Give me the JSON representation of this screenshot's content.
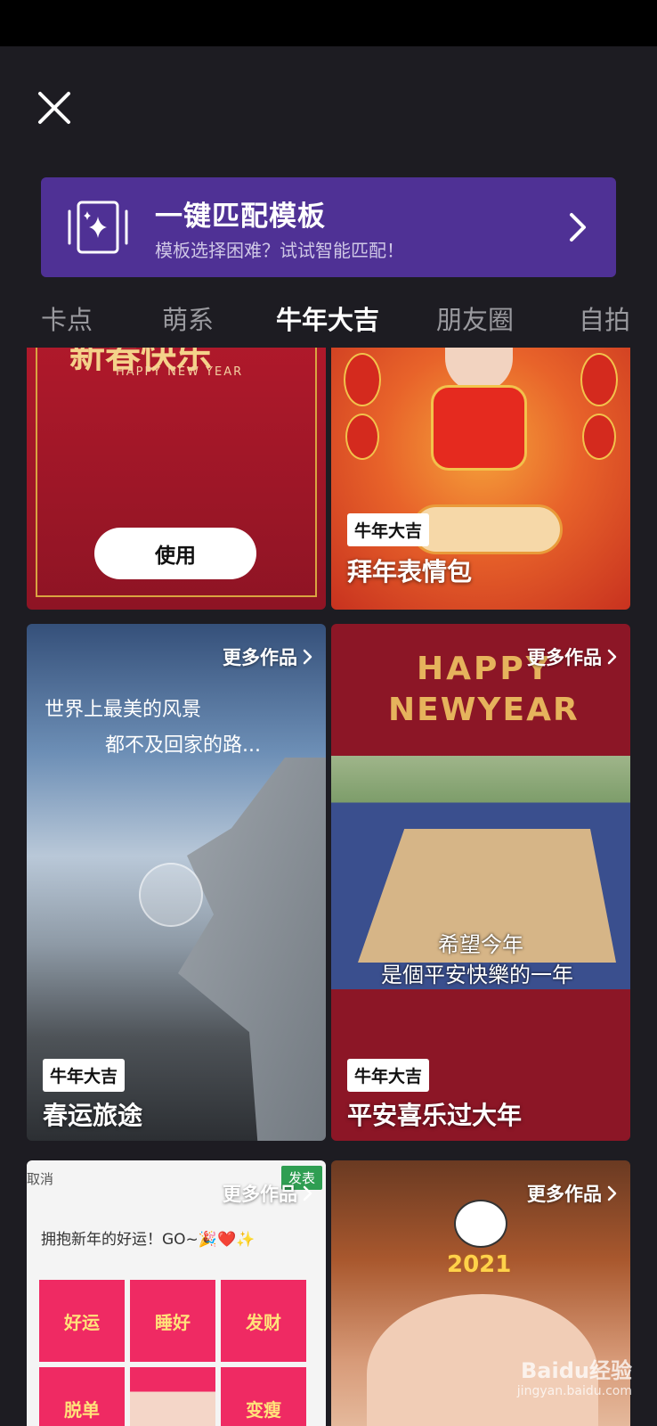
{
  "header": {
    "close_icon": "close-icon"
  },
  "banner": {
    "title": "一键匹配模板",
    "subtitle": "模板选择困难？试试智能匹配！",
    "icon": "sparkle-card-icon",
    "arrow_icon": "chevron-right-icon",
    "color": "#4f3195"
  },
  "tabs": [
    {
      "label": "卡点",
      "active": false
    },
    {
      "label": "萌系",
      "active": false
    },
    {
      "label": "牛年大吉",
      "active": true
    },
    {
      "label": "朋友圈",
      "active": false
    },
    {
      "label": "自拍",
      "active": false
    }
  ],
  "cards": [
    {
      "art_title": "新春快乐",
      "art_sub": "HAPPY NEW YEAR",
      "use_label": "使用"
    },
    {
      "tag": "牛年大吉",
      "title": "拜年表情包"
    },
    {
      "more": "更多作品",
      "art_line1": "世界上最美的风景",
      "art_line2": "都不及回家的路...",
      "tag": "牛年大吉",
      "title": "春运旅途"
    },
    {
      "more": "更多作品",
      "art_title1": "HAPPY",
      "art_title2": "NEWYEAR",
      "caption1": "希望今年",
      "caption2": "是個平安快樂的一年",
      "tag": "牛年大吉",
      "title": "平安喜乐过大年"
    },
    {
      "more": "更多作品",
      "cancel": "取消",
      "publish": "发表",
      "post_text": "拥抱新年的好运！GO~🎉❤️✨",
      "tiles": [
        "好运",
        "睡好",
        "发财",
        "脱单",
        "",
        "变瘦"
      ]
    },
    {
      "more": "更多作品",
      "art_year": "2021"
    }
  ],
  "watermark": {
    "line1": "Baidu经验",
    "line2": "jingyan.baidu.com"
  }
}
